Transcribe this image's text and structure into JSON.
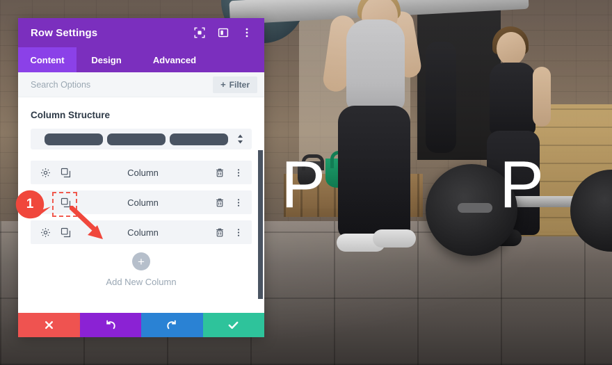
{
  "app": {
    "background_image_description": "gym interior with women lifting barbells",
    "overlay_letters": [
      "P",
      "P"
    ]
  },
  "panel": {
    "header": {
      "title": "Row Settings",
      "icons": [
        {
          "name": "focus-icon",
          "glyph": "focus"
        },
        {
          "name": "layout-panel-icon",
          "glyph": "panel"
        },
        {
          "name": "more-options-icon",
          "glyph": "dots-vertical"
        }
      ]
    },
    "tabs": [
      {
        "label": "Content",
        "active": true
      },
      {
        "label": "Design",
        "active": false
      },
      {
        "label": "Advanced",
        "active": false
      }
    ],
    "search": {
      "placeholder": "Search Options",
      "value": "",
      "filter_label": "Filter",
      "filter_plus": "+"
    },
    "content": {
      "section_title": "Column Structure",
      "structure_picker": {
        "columns": 3,
        "caret_icon": "updown-caret-icon"
      },
      "columns": [
        {
          "label": "Column",
          "settings_icon": "gear-icon",
          "duplicate_icon": "duplicate-icon",
          "delete_icon": "trash-icon",
          "more_icon": "dots-vertical-icon",
          "highlighted": false
        },
        {
          "label": "Column",
          "settings_icon": "gear-icon",
          "duplicate_icon": "duplicate-icon",
          "delete_icon": "trash-icon",
          "more_icon": "dots-vertical-icon",
          "highlighted": true
        },
        {
          "label": "Column",
          "settings_icon": "gear-icon",
          "duplicate_icon": "duplicate-icon",
          "delete_icon": "trash-icon",
          "more_icon": "dots-vertical-icon",
          "highlighted": false
        }
      ],
      "add_column": {
        "plus": "+",
        "label": "Add New Column"
      }
    },
    "footer": [
      {
        "name": "cancel-button",
        "icon": "close-icon",
        "color": "#ef5350"
      },
      {
        "name": "undo-button",
        "icon": "undo-icon",
        "color": "#8b22d4"
      },
      {
        "name": "redo-button",
        "icon": "redo-icon",
        "color": "#2a82d4"
      },
      {
        "name": "save-button",
        "icon": "checkmark-icon",
        "color": "#2ec39b"
      }
    ]
  },
  "annotation": {
    "step_number": "1",
    "marker_color": "#f0473c",
    "arrow_color": "#f0473c",
    "dashed_box_color": "#f05a4f"
  },
  "colors": {
    "header_purple": "#7b2fbe",
    "active_tab_purple": "#8b41e8",
    "panel_bg": "#ffffff",
    "row_bg": "#f2f4f7",
    "icon_dark": "#4a5462",
    "muted_text": "#9aa7b4"
  }
}
